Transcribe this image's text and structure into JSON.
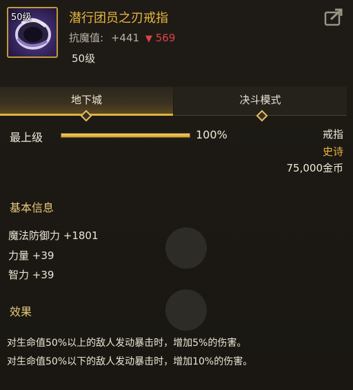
{
  "item": {
    "name": "潜行团员之刃戒指",
    "icon_level": "50级",
    "stat_label": "抗魔值:",
    "stat_plus": "+441",
    "stat_minus": "569",
    "level": "50级"
  },
  "tabs": [
    {
      "label": "地下城",
      "active": true
    },
    {
      "label": "决斗模式",
      "active": false
    }
  ],
  "rank": {
    "label": "最上级",
    "percent_text": "100%",
    "fill_fraction": 1.0
  },
  "info": {
    "type": "戒指",
    "rarity": "史诗",
    "price": "75,000金币"
  },
  "basic_info": {
    "title": "基本信息",
    "stats": [
      "魔法防御力 +1801",
      "力量 +39",
      "智力 +39"
    ]
  },
  "effect": {
    "title": "效果",
    "lines": [
      "对生命值50%以上的敌人发动暴击时，增加5%的伤害。",
      "对生命值50%以下的敌人发动暴击时，增加10%的伤害。"
    ]
  },
  "colors": {
    "accent_gold": "#e9b640",
    "down_red": "#e0404a",
    "background": "#1b1813"
  },
  "icons": {
    "share": "share-icon",
    "down": "arrow-down-icon"
  }
}
